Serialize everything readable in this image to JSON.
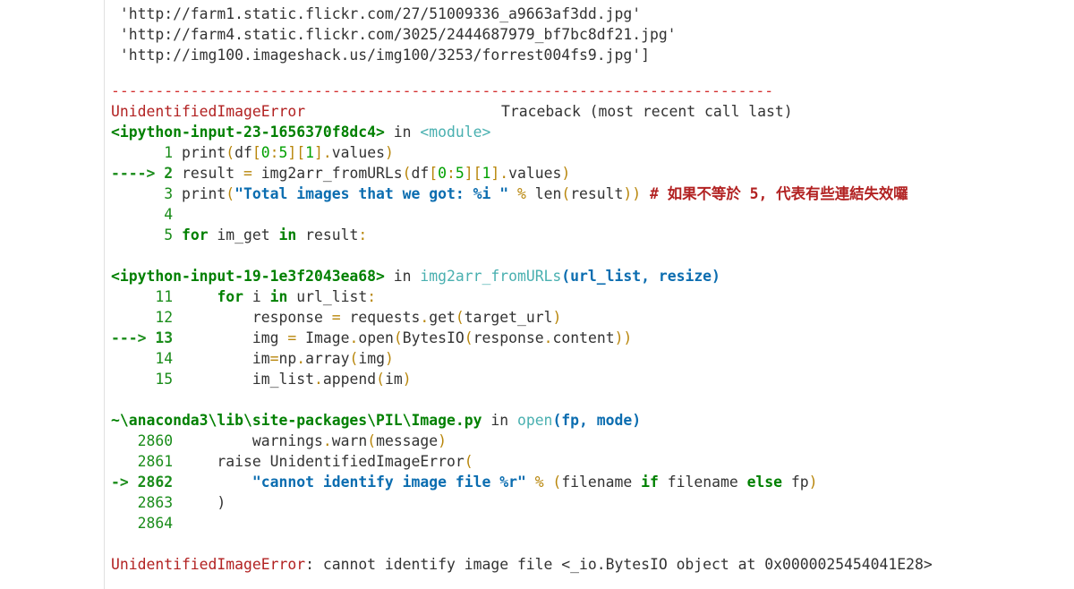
{
  "list_lines": [
    " 'http://farm1.static.flickr.com/27/51009336_a9663af3dd.jpg'",
    " 'http://farm4.static.flickr.com/3025/2444687979_bf7bc8df21.jpg'",
    " 'http://img100.imageshack.us/img100/3253/forrest004fs9.jpg']"
  ],
  "rule": "---------------------------------------------------------------------------",
  "error_name": "UnidentifiedImageError",
  "traceback_header": "Traceback (most recent call last)",
  "frame1": {
    "file": "<ipython-input-23-1656370f8dc4>",
    "in": " in ",
    "func": "<module>",
    "lines": [
      {
        "num": "      1 ",
        "code": "print(df[0:5][1].values)"
      },
      {
        "num": "----> 2 ",
        "code": "result = img2arr_fromURLs(df[0:5][1].values)"
      },
      {
        "num": "      3 ",
        "code": "print(\"Total images that we got: %i \" % len(result)) # 如果不等於 5, 代表有些連結失效囉"
      },
      {
        "num": "      4 ",
        "code": ""
      },
      {
        "num": "      5 ",
        "code": "for im_get in result:"
      }
    ]
  },
  "frame2": {
    "file": "<ipython-input-19-1e3f2043ea68>",
    "in": " in ",
    "func": "img2arr_fromURLs",
    "args": "(url_list, resize)",
    "lines": [
      {
        "num": "     11 ",
        "code": "    for i in url_list:"
      },
      {
        "num": "     12 ",
        "code": "        response = requests.get(target_url)"
      },
      {
        "num": "---> 13 ",
        "code": "        img = Image.open(BytesIO(response.content))"
      },
      {
        "num": "     14 ",
        "code": "        im=np.array(img)"
      },
      {
        "num": "     15 ",
        "code": "        im_list.append(im)"
      }
    ]
  },
  "frame3": {
    "file": "~\\anaconda3\\lib\\site-packages\\PIL\\Image.py",
    "in": " in ",
    "func": "open",
    "args": "(fp, mode)",
    "lines": [
      {
        "num": "   2860 ",
        "code": "        warnings.warn(message)"
      },
      {
        "num": "   2861 ",
        "code": "    raise UnidentifiedImageError("
      },
      {
        "num": "-> 2862 ",
        "code": "        \"cannot identify image file %r\" % (filename if filename else fp)"
      },
      {
        "num": "   2863 ",
        "code": "    )"
      },
      {
        "num": "   2864 ",
        "code": ""
      }
    ]
  },
  "final_error": {
    "name": "UnidentifiedImageError",
    "message": ": cannot identify image file <_io.BytesIO object at 0x0000025454041E28>"
  },
  "colors": {
    "error": "#b22222",
    "frame_file": "#008000",
    "keyword": "#008000",
    "string": "#0b6db0",
    "module": "#49b0b0",
    "operator": "#b8860b"
  }
}
